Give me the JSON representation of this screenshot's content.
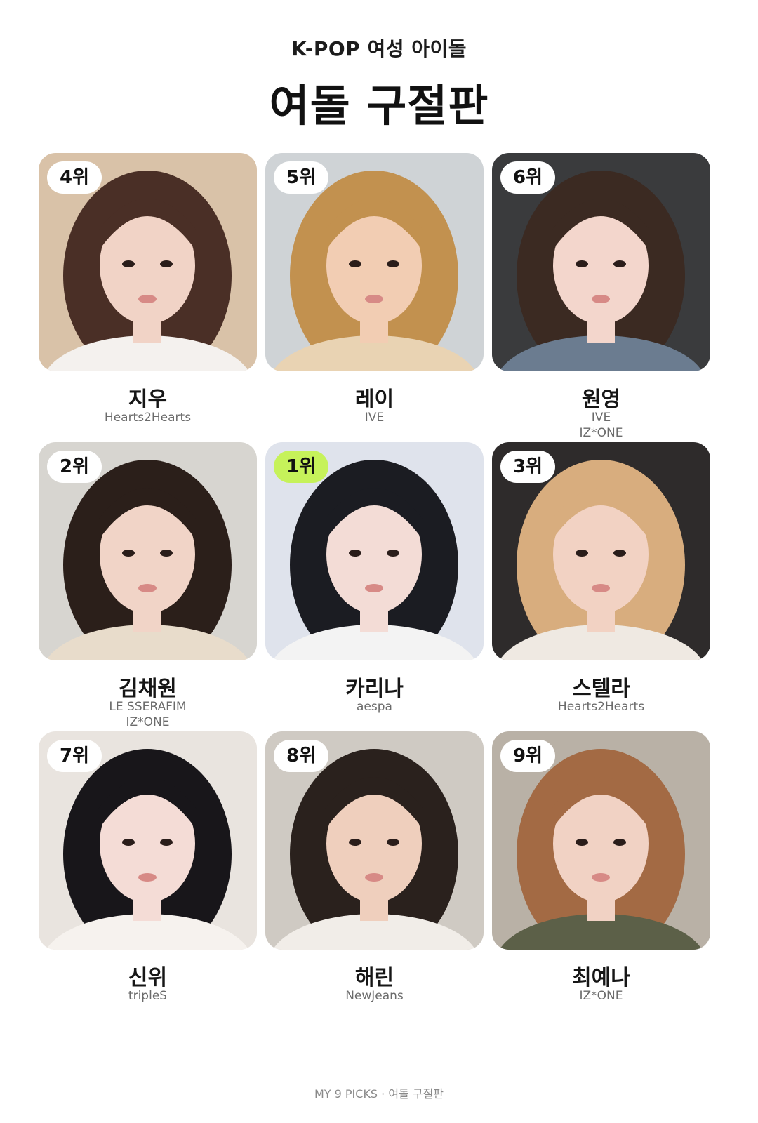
{
  "header": {
    "subtitle": "K-POP 여성 아이돌",
    "title": "여돌 구절판"
  },
  "accent_color": "#c6f25a",
  "cards": [
    {
      "rank": "4위",
      "name": "지우",
      "groups": [
        "Hearts2Hearts"
      ],
      "photo": {
        "bg": "#d9c2a8",
        "hair": "#4a2f26",
        "skin": "#f1d3c6",
        "cloth": "#f4f1ee"
      }
    },
    {
      "rank": "5위",
      "name": "레이",
      "groups": [
        "IVE"
      ],
      "photo": {
        "bg": "#cfd3d6",
        "hair": "#c2914f",
        "skin": "#f2cdb3",
        "cloth": "#e9d3b3"
      }
    },
    {
      "rank": "6위",
      "name": "원영",
      "groups": [
        "IVE",
        "IZ*ONE"
      ],
      "photo": {
        "bg": "#3a3b3d",
        "hair": "#3b2a22",
        "skin": "#f3d6cc",
        "cloth": "#6b7c90"
      }
    },
    {
      "rank": "2위",
      "name": "김채원",
      "groups": [
        "LE SSERAFIM",
        "IZ*ONE"
      ],
      "photo": {
        "bg": "#d7d5d0",
        "hair": "#2b1f1a",
        "skin": "#f1d4c7",
        "cloth": "#e8dccb"
      }
    },
    {
      "rank": "1위",
      "name": "카리나",
      "groups": [
        "aespa"
      ],
      "photo": {
        "bg": "#dfe3ec",
        "hair": "#1b1c22",
        "skin": "#f3dcd6",
        "cloth": "#f3f3f3"
      }
    },
    {
      "rank": "3위",
      "name": "스텔라",
      "groups": [
        "Hearts2Hearts"
      ],
      "photo": {
        "bg": "#2e2b2b",
        "hair": "#d8ad7e",
        "skin": "#f2d2c3",
        "cloth": "#efe9e2"
      }
    },
    {
      "rank": "7위",
      "name": "신위",
      "groups": [
        "tripleS"
      ],
      "photo": {
        "bg": "#e9e4df",
        "hair": "#18161a",
        "skin": "#f4dcd6",
        "cloth": "#f6f2ee"
      }
    },
    {
      "rank": "8위",
      "name": "해린",
      "groups": [
        "NewJeans"
      ],
      "photo": {
        "bg": "#cfcac3",
        "hair": "#2a211d",
        "skin": "#efcfbd",
        "cloth": "#f1ede8"
      }
    },
    {
      "rank": "9위",
      "name": "최예나",
      "groups": [
        "IZ*ONE"
      ],
      "photo": {
        "bg": "#b9b1a6",
        "hair": "#a36a44",
        "skin": "#f1d2c4",
        "cloth": "#5c6048"
      }
    }
  ],
  "footer": "MY 9 PICKS · 여돌 구절판"
}
